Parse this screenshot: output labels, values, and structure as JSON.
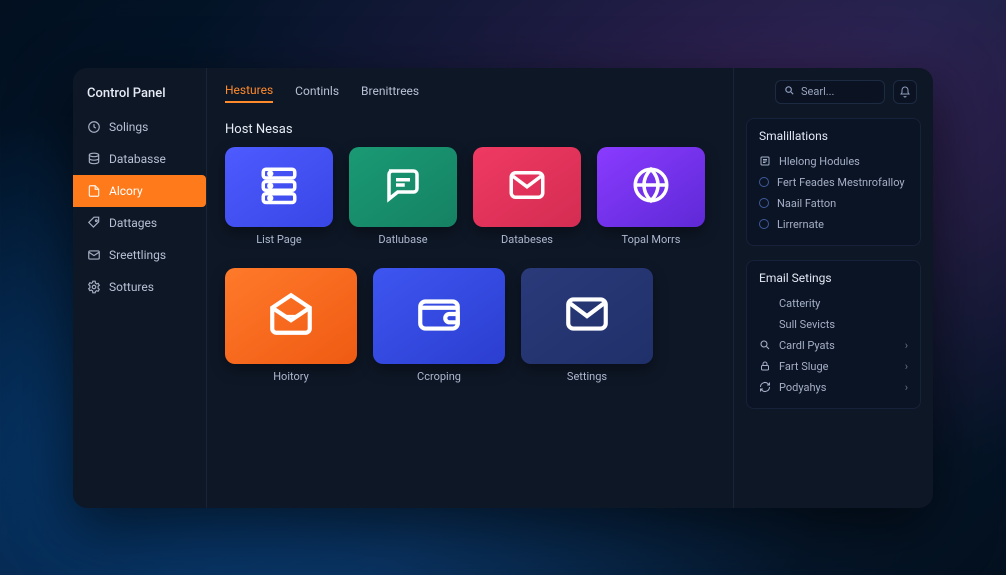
{
  "sidebar": {
    "title": "Control Panel",
    "items": [
      {
        "icon": "clock",
        "label": "Solings"
      },
      {
        "icon": "database",
        "label": "Databasse"
      },
      {
        "icon": "file",
        "label": "Alcory"
      },
      {
        "icon": "tag",
        "label": "Dattages"
      },
      {
        "icon": "mail",
        "label": "Sreettlings"
      },
      {
        "icon": "gear",
        "label": "Sottures"
      }
    ],
    "active_index": 2
  },
  "tabs": {
    "items": [
      "Hestures",
      "Continls",
      "Brenittrees"
    ],
    "active_index": 0
  },
  "search": {
    "placeholder": "Searl..."
  },
  "main": {
    "section_title": "Host Nesas",
    "cards_row1": [
      {
        "color": "c-blue",
        "icon": "server",
        "label": "List Page"
      },
      {
        "color": "c-green",
        "icon": "chat",
        "label": "Datlubase"
      },
      {
        "color": "c-red",
        "icon": "envelope",
        "label": "Databeses"
      },
      {
        "color": "c-purple",
        "icon": "globe",
        "label": "Topal Morrs"
      }
    ],
    "cards_row2": [
      {
        "color": "c-orange",
        "icon": "mail-open",
        "label": "Hoitory"
      },
      {
        "color": "c-blue2",
        "icon": "wallet",
        "label": "Ccroping"
      },
      {
        "color": "c-navy",
        "icon": "envelope",
        "label": "Settings"
      }
    ]
  },
  "right": {
    "box1": {
      "title": "Smalillations",
      "items": [
        {
          "icon": "list",
          "label": "Hlelong Hodules"
        },
        {
          "icon": "radio",
          "label": "Fert Feades Mestnrofalloy"
        },
        {
          "icon": "radio",
          "label": "Naail Fatton"
        },
        {
          "icon": "radio",
          "label": "Lirrernate"
        }
      ]
    },
    "box2": {
      "title": "Email Setings",
      "items": [
        {
          "icon": "",
          "label": "Catterity",
          "chev": false
        },
        {
          "icon": "",
          "label": "Sull Sevicts",
          "chev": false
        },
        {
          "icon": "search",
          "label": "Cardl Pyats",
          "chev": true
        },
        {
          "icon": "lock",
          "label": "Fart Sluge",
          "chev": true
        },
        {
          "icon": "refresh",
          "label": "Podyahys",
          "chev": true
        }
      ]
    }
  }
}
